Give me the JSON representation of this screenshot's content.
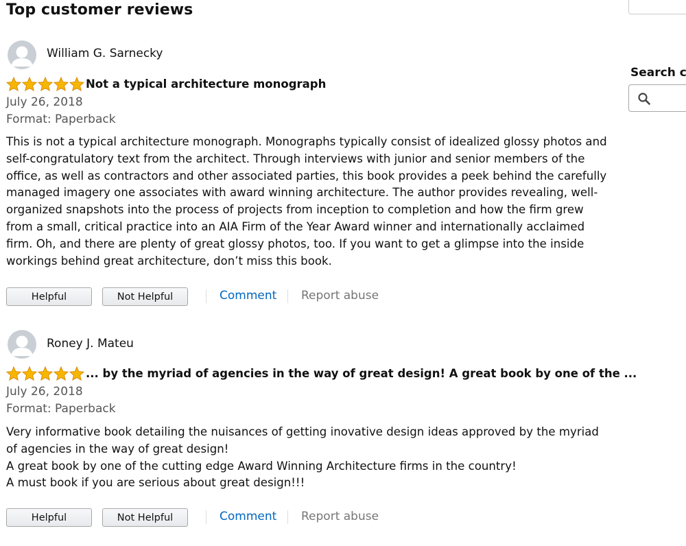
{
  "page": {
    "title": "Top customer reviews"
  },
  "sidebar": {
    "search_label": "Search cu",
    "search_icon": "search-icon"
  },
  "colors": {
    "star": "#f7b600",
    "star_outline": "#d88700",
    "link": "#0066c0",
    "muted_text": "#555555",
    "avatar_bg": "#c9cfd4"
  },
  "reviews": [
    {
      "reviewer": "William G. Sarnecky",
      "rating": 5,
      "title": "Not a typical architecture monograph",
      "date": "July 26, 2018",
      "format": "Format: Paperback",
      "body": [
        "This is not a typical architecture monograph. Monographs typically consist of idealized glossy photos and self-congratulatory text from the architect. Through interviews with junior and senior members of the office, as well as contractors and other associated parties, this book provides a peek behind the carefully managed imagery one associates with award winning architecture. The author provides revealing, well-organized snapshots into the process of projects from inception to completion and how the firm grew from a small, critical practice into an AIA Firm of the Year Award winner and internationally acclaimed firm. Oh, and there are plenty of great glossy photos, too. If you want to get a glimpse into the inside workings behind great architecture, don’t miss this book."
      ],
      "helpful_label": "Helpful",
      "not_helpful_label": "Not Helpful",
      "comment_label": "Comment",
      "report_label": "Report abuse"
    },
    {
      "reviewer": "Roney J. Mateu",
      "rating": 5,
      "title": "... by the myriad of agencies in the way of great design! A great book by one of the ...",
      "date": "July 26, 2018",
      "format": "Format: Paperback",
      "body": [
        "Very informative book detailing the nuisances of getting inovative design ideas approved by the myriad of agencies in the way of great design!",
        "A great book by one of the cutting edge Award Winning Architecture firms in the country!",
        "A must book if you are serious about great design!!!"
      ],
      "helpful_label": "Helpful",
      "not_helpful_label": "Not Helpful",
      "comment_label": "Comment",
      "report_label": "Report abuse"
    }
  ]
}
